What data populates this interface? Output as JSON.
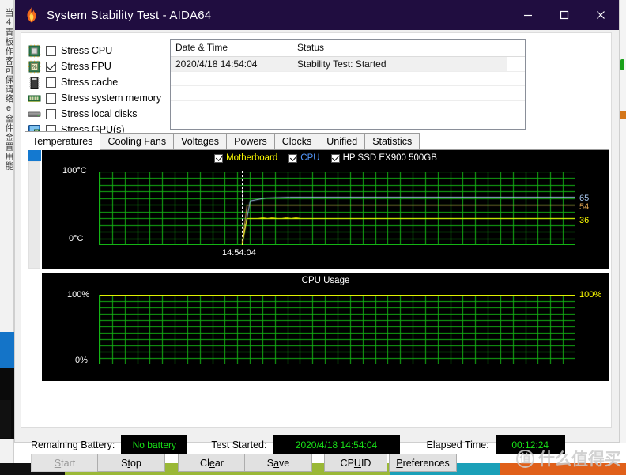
{
  "window": {
    "title": "System Stability Test - AIDA64",
    "app_icon": "flame-icon",
    "minimize": "–",
    "maximize": "☐",
    "close": "✕",
    "titlebar_color": "#200d40"
  },
  "stress_options": [
    {
      "label": "Stress CPU",
      "checked": false,
      "icon": "cpu-chip-icon"
    },
    {
      "label": "Stress FPU",
      "checked": true,
      "icon": "fpu-chip-icon"
    },
    {
      "label": "Stress cache",
      "checked": false,
      "icon": "cache-chip-icon"
    },
    {
      "label": "Stress system memory",
      "checked": false,
      "icon": "memory-module-icon"
    },
    {
      "label": "Stress local disks",
      "checked": false,
      "icon": "hard-disk-icon"
    },
    {
      "label": "Stress GPU(s)",
      "checked": false,
      "icon": "gpu-monitor-icon"
    }
  ],
  "log": {
    "columns": [
      "Date & Time",
      "Status",
      ""
    ],
    "rows": [
      {
        "datetime": "2020/4/18 14:54:04",
        "status": "Stability Test: Started",
        "selected": true
      },
      {
        "datetime": "",
        "status": "",
        "selected": false
      },
      {
        "datetime": "",
        "status": "",
        "selected": false
      },
      {
        "datetime": "",
        "status": "",
        "selected": false
      },
      {
        "datetime": "",
        "status": "",
        "selected": false
      }
    ]
  },
  "tabs": [
    {
      "label": "Temperatures",
      "active": true
    },
    {
      "label": "Cooling Fans",
      "active": false
    },
    {
      "label": "Voltages",
      "active": false
    },
    {
      "label": "Powers",
      "active": false
    },
    {
      "label": "Clocks",
      "active": false
    },
    {
      "label": "Unified",
      "active": false
    },
    {
      "label": "Statistics",
      "active": false
    }
  ],
  "chart_data": [
    {
      "type": "line",
      "name": "temperatures-graph",
      "title": "",
      "xlabel": "",
      "ylabel": "",
      "ylim": [
        0,
        100
      ],
      "y_top_label": "100°C",
      "y_bottom_label": "0°C",
      "x_tick_label": "14:54:04",
      "grid": true,
      "grid_color": "#14b414",
      "background": "#000000",
      "legend_position": "top-center",
      "series": [
        {
          "name": "Motherboard",
          "color": "#ffff00",
          "current_value": 36,
          "value_label": "36"
        },
        {
          "name": "CPU",
          "color": "#a8c8f0",
          "current_value": 65,
          "value_label": "65"
        },
        {
          "name": "HP SSD EX900 500GB",
          "color": "#d8a050",
          "current_value": 54,
          "value_label": "54"
        }
      ],
      "legend": [
        {
          "label": "Motherboard",
          "color": "#ffff00",
          "checked": true
        },
        {
          "label": "CPU",
          "color": "#5599ff",
          "checked": true
        },
        {
          "label": "HP SSD EX900 500GB",
          "color": "#ffffff",
          "checked": true
        }
      ]
    },
    {
      "type": "line",
      "name": "cpu-usage-graph",
      "title": "CPU Usage",
      "xlabel": "",
      "ylabel": "",
      "ylim": [
        0,
        100
      ],
      "y_top_label": "100%",
      "y_bottom_label": "0%",
      "grid": true,
      "grid_color": "#14b414",
      "background": "#000000",
      "series": [
        {
          "name": "CPU Usage",
          "color": "#ffff00",
          "current_value": 100,
          "value_label": "100%"
        }
      ]
    }
  ],
  "status": {
    "battery_label": "Remaining Battery:",
    "battery_value": "No battery",
    "started_label": "Test Started:",
    "started_value": "2020/4/18 14:54:04",
    "elapsed_label": "Elapsed Time:",
    "elapsed_value": "00:12:24",
    "value_color": "#18e018"
  },
  "buttons": [
    {
      "label": "Start",
      "accel_index": 0,
      "disabled": true
    },
    {
      "label": "Stop",
      "accel_index": 1,
      "disabled": false
    },
    {
      "label": "Clear",
      "accel_index": 2,
      "disabled": false
    },
    {
      "label": "Save",
      "accel_index": 1,
      "disabled": false
    },
    {
      "label": "CPUID",
      "accel_index": 3,
      "disabled": false
    },
    {
      "label": "Preferences",
      "accel_index": 0,
      "disabled": false
    }
  ],
  "background": {
    "left_text": "当4青板作客可保请络e窒件金置用能",
    "watermark_mark": "值",
    "watermark_text": "什么值得买"
  }
}
